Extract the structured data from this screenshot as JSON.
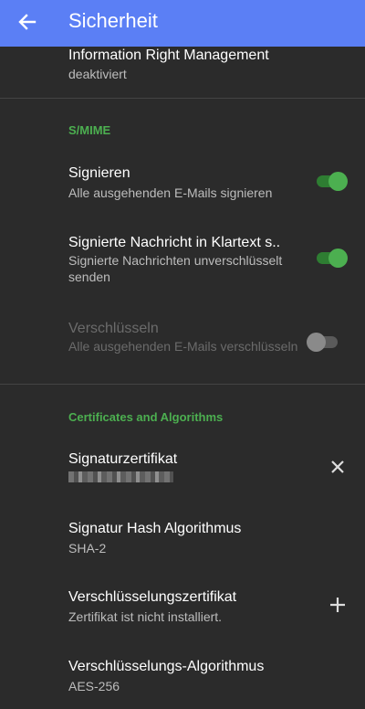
{
  "appbar": {
    "title": "Sicherheit"
  },
  "irm": {
    "title": "Information Right Management",
    "subtitle": "deaktiviert"
  },
  "smime": {
    "header": "S/MIME",
    "sign": {
      "title": "Signieren",
      "subtitle": "Alle ausgehenden E-Mails signieren",
      "enabled": true
    },
    "cleartext": {
      "title": "Signierte Nachricht in Klartext s..",
      "subtitle": "Signierte Nachrichten unverschlüsselt senden",
      "enabled": true
    },
    "encrypt": {
      "title": "Verschlüsseln",
      "subtitle": "Alle ausgehenden E-Mails verschlüsseln",
      "enabled": false
    }
  },
  "certs": {
    "header": "Certificates and Algorithms",
    "sig_cert": {
      "title": "Signaturzertifikat"
    },
    "sig_hash": {
      "title": "Signatur Hash Algorithmus",
      "subtitle": "SHA-2"
    },
    "enc_cert": {
      "title": "Verschlüsselungszertifikat",
      "subtitle": "Zertifikat ist nicht installiert."
    },
    "enc_algo": {
      "title": "Verschlüsselungs-Algorithmus",
      "subtitle": "AES-256"
    }
  },
  "colors": {
    "appbar": "#5b7ff5",
    "accent": "#4caf50",
    "background": "#2b2b2b"
  }
}
